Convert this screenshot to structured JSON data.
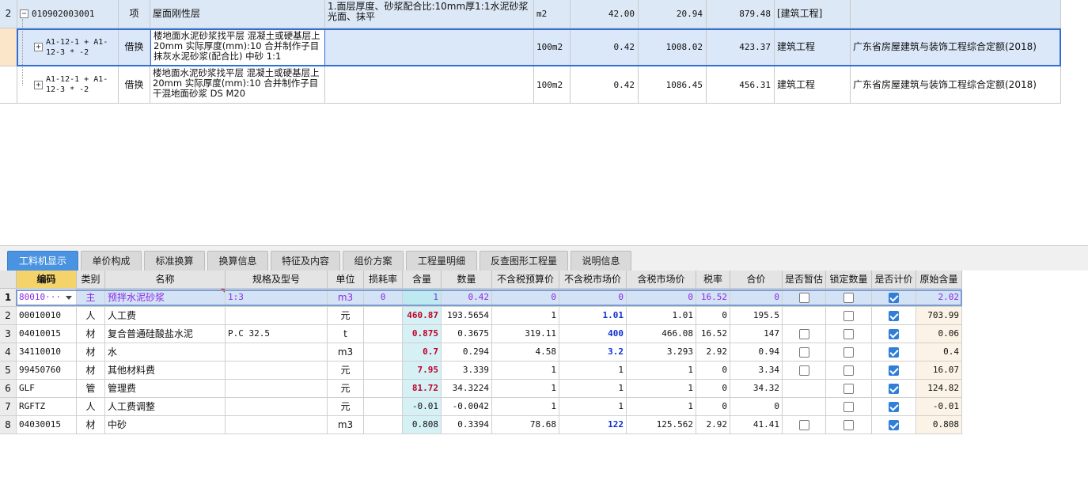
{
  "upper_rows": [
    {
      "rownum": "2",
      "expander": "−",
      "code": "010902003001",
      "type": "项",
      "name": "屋面刚性层",
      "feature": "1.面层厚度、砂浆配合比:10mm厚1:1水泥砂浆光面、抹平",
      "unit": "m2",
      "qty": "42.00",
      "price": "20.94",
      "total": "879.48",
      "major": "[建筑工程]",
      "norm": ""
    },
    {
      "rownum": "",
      "expander": "+",
      "code": "A1-12-1 + A1-12-3 * -2",
      "type": "借换",
      "name": "楼地面水泥砂浆找平层 混凝土或硬基层上 20mm  实际厚度(mm):10  合并制作子目 抹灰水泥砂浆(配合比) 中砂 1:1",
      "feature": "",
      "unit": "100m2",
      "qty": "0.42",
      "price": "1008.02",
      "total": "423.37",
      "major": "建筑工程",
      "norm": "广东省房屋建筑与装饰工程综合定额(2018)"
    },
    {
      "rownum": "",
      "expander": "+",
      "code": "A1-12-1 + A1-12-3 * -2",
      "type": "借换",
      "name": "楼地面水泥砂浆找平层 混凝土或硬基层上 20mm  实际厚度(mm):10  合并制作子目 干混地面砂浆 DS M20",
      "feature": "",
      "unit": "100m2",
      "qty": "0.42",
      "price": "1086.45",
      "total": "456.31",
      "major": "建筑工程",
      "norm": "广东省房屋建筑与装饰工程综合定额(2018)"
    }
  ],
  "tabs": [
    "工料机显示",
    "单价构成",
    "标准换算",
    "换算信息",
    "特征及内容",
    "组价方案",
    "工程量明细",
    "反查图形工程量",
    "说明信息"
  ],
  "active_tab": 0,
  "resource_headers": [
    "",
    "编码",
    "类别",
    "名称",
    "规格及型号",
    "单位",
    "损耗率",
    "含量",
    "数量",
    "不含税预算价",
    "不含税市场价",
    "含税市场价",
    "税率",
    "合价",
    "是否暂估",
    "锁定数量",
    "是否计价",
    "原始含量"
  ],
  "resource_rows": [
    {
      "rn": "1",
      "code": "80010···",
      "cat": "主",
      "name": "预拌水泥砂浆",
      "spec": "1:3",
      "unit": "m3",
      "loss": "0",
      "content": "1",
      "qty": "0.42",
      "budget": "0",
      "market": "0",
      "tax_market": "0",
      "tax": "16.52",
      "total": "0",
      "est": false,
      "lock": false,
      "priced": true,
      "orig": "2.02"
    },
    {
      "rn": "2",
      "code": "00010010",
      "cat": "人",
      "name": "人工费",
      "spec": "",
      "unit": "元",
      "loss": "",
      "content": "460.87",
      "qty": "193.5654",
      "budget": "1",
      "market": "1.01",
      "tax_market": "1.01",
      "tax": "0",
      "total": "195.5",
      "est": null,
      "lock": false,
      "priced": true,
      "orig": "703.99"
    },
    {
      "rn": "3",
      "code": "04010015",
      "cat": "材",
      "name": "复合普通硅酸盐水泥",
      "spec": "P.C 32.5",
      "unit": "t",
      "loss": "",
      "content": "0.875",
      "qty": "0.3675",
      "budget": "319.11",
      "market": "400",
      "tax_market": "466.08",
      "tax": "16.52",
      "total": "147",
      "est": false,
      "lock": false,
      "priced": true,
      "orig": "0.06"
    },
    {
      "rn": "4",
      "code": "34110010",
      "cat": "材",
      "name": "水",
      "spec": "",
      "unit": "m3",
      "loss": "",
      "content": "0.7",
      "qty": "0.294",
      "budget": "4.58",
      "market": "3.2",
      "tax_market": "3.293",
      "tax": "2.92",
      "total": "0.94",
      "est": false,
      "lock": false,
      "priced": true,
      "orig": "0.4"
    },
    {
      "rn": "5",
      "code": "99450760",
      "cat": "材",
      "name": "其他材料费",
      "spec": "",
      "unit": "元",
      "loss": "",
      "content": "7.95",
      "qty": "3.339",
      "budget": "1",
      "market": "1",
      "tax_market": "1",
      "tax": "0",
      "total": "3.34",
      "est": false,
      "lock": false,
      "priced": true,
      "orig": "16.07"
    },
    {
      "rn": "6",
      "code": "GLF",
      "cat": "管",
      "name": "管理费",
      "spec": "",
      "unit": "元",
      "loss": "",
      "content": "81.72",
      "qty": "34.3224",
      "budget": "1",
      "market": "1",
      "tax_market": "1",
      "tax": "0",
      "total": "34.32",
      "est": null,
      "lock": false,
      "priced": true,
      "orig": "124.82"
    },
    {
      "rn": "7",
      "code": "RGFTZ",
      "cat": "人",
      "name": "人工费调整",
      "spec": "",
      "unit": "元",
      "loss": "",
      "content": "-0.01",
      "qty": "-0.0042",
      "budget": "1",
      "market": "1",
      "tax_market": "1",
      "tax": "0",
      "total": "0",
      "est": null,
      "lock": false,
      "priced": true,
      "orig": "-0.01"
    },
    {
      "rn": "8",
      "code": "04030015",
      "cat": "材",
      "name": "中砂",
      "spec": "",
      "unit": "m3",
      "loss": "",
      "content": "0.808",
      "qty": "0.3394",
      "budget": "78.68",
      "market": "122",
      "tax_market": "125.562",
      "tax": "2.92",
      "total": "41.41",
      "est": false,
      "lock": false,
      "priced": true,
      "orig": "0.808"
    }
  ],
  "styles": {
    "content_red_rows": [
      1,
      2,
      3,
      4,
      5
    ],
    "market_blue_rows": [
      1,
      2,
      3,
      7
    ],
    "accent": "#4a93e0",
    "selection": "#2f6fd6"
  }
}
